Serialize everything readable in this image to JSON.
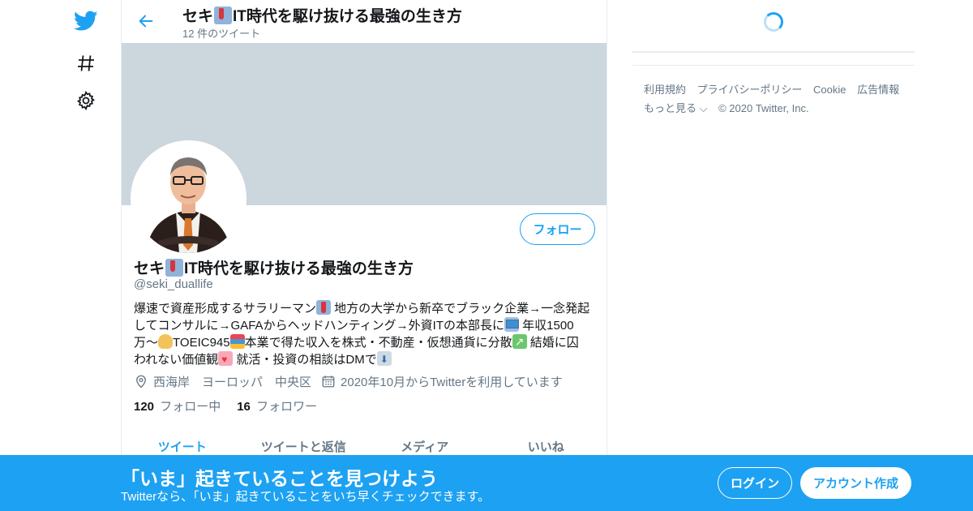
{
  "nav": {
    "logo_icon": "twitter-bird-icon",
    "explore_icon": "hashtag-icon",
    "settings_icon": "gear-icon",
    "accent_color": "#1da1f2"
  },
  "header": {
    "back_icon": "arrow-left-icon",
    "title_prefix": "セキ",
    "title_suffix": "IT時代を駆け抜ける最強の生き方",
    "tweet_count": "12 件のツイート"
  },
  "profile": {
    "follow_label": "フォロー",
    "name_prefix": "セキ",
    "name_suffix": "IT時代を駆け抜ける最強の生き方",
    "handle": "@seki_duallife",
    "bio": {
      "l1a": "爆速で資産形成するサラリーマン",
      "l1b": " 地方の大学から新卒でブラック企業→一念発起",
      "l2a": "してコンサルに→GAFAからヘッドハンティング→外資ITの本部長に",
      "l2b": " 年収1500",
      "l3a": "万〜",
      "l3b": "TOEIC945",
      "l3c": "本業で得た収入を株式・不動産・仮想通貨に分散",
      "l3d": " 結婚に囚",
      "l4a": "われない価値観",
      "l4b": " 就活・投資の相談はDMで"
    },
    "location": "西海岸　ヨーロッパ　中央区",
    "joined": "2020年10月からTwitterを利用しています",
    "following_count": "120",
    "following_label": "フォロー中",
    "followers_count": "16",
    "followers_label": "フォロワー"
  },
  "tabs": [
    {
      "label": "ツイート"
    },
    {
      "label": "ツイートと返信"
    },
    {
      "label": "メディア"
    },
    {
      "label": "いいね"
    }
  ],
  "sidebar": {
    "links": [
      "利用規約",
      "プライバシーポリシー",
      "Cookie",
      "広告情報",
      "もっと見る ⌵"
    ],
    "copyright": "© 2020 Twitter, Inc."
  },
  "bottom_bar": {
    "title": "「いま」起きていることを見つけよう",
    "subtitle": "Twitterなら、「いま」起きていることをいち早くチェックできます。",
    "login_label": "ログイン",
    "signup_label": "アカウント作成"
  }
}
